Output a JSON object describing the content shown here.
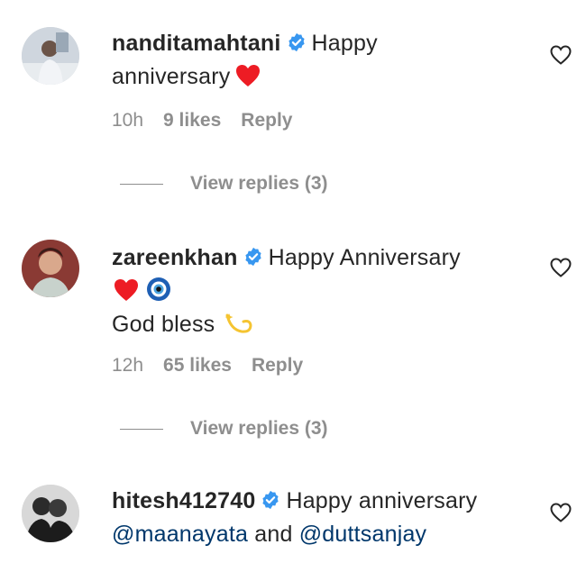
{
  "comments": [
    {
      "username": "nanditamahtani",
      "line1": "Happy",
      "line2": "anniversary",
      "time": "10h",
      "likes": "9 likes",
      "reply": "Reply",
      "view_replies": "View replies (3)"
    },
    {
      "username": "zareenkhan",
      "line1": "Happy Anniversary",
      "line3": "God bless",
      "time": "12h",
      "likes": "65 likes",
      "reply": "Reply",
      "view_replies": "View replies (3)"
    },
    {
      "username": "hitesh412740",
      "line1": "Happy anniversary",
      "mention1": "@maanayata",
      "connector": "and",
      "mention2": "@duttsanjay"
    }
  ],
  "colors": {
    "verified": "#3897f0",
    "heart_emoji": "#ed1c24",
    "muted": "#8e8e8e",
    "mention": "#00376b"
  },
  "icons": [
    "verified-badge-icon",
    "red-heart-emoji-icon",
    "nazar-amulet-emoji-icon",
    "dizzy-emoji-icon",
    "like-heart-icon"
  ]
}
